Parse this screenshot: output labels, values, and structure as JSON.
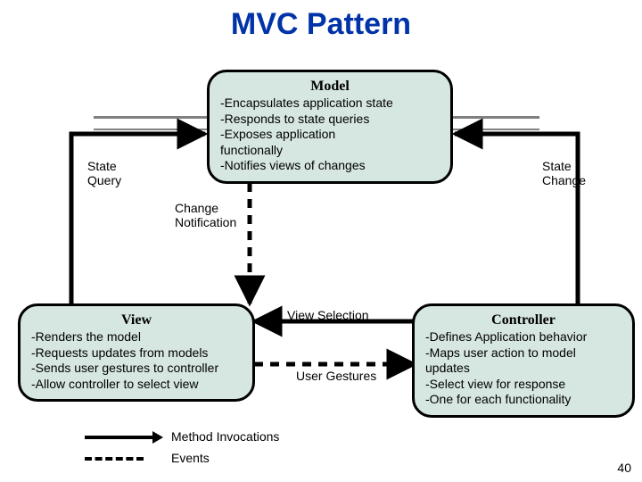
{
  "title": "MVC Pattern",
  "slide_number": "40",
  "model": {
    "heading": "Model",
    "l1": "-Encapsulates application state",
    "l2": "-Responds to state queries",
    "l3": "-Exposes application",
    "l4": " functionally",
    "l5": "-Notifies views of changes"
  },
  "view": {
    "heading": "View",
    "l1": "-Renders the model",
    "l2": "-Requests updates from models",
    "l3": "-Sends user gestures to controller",
    "l4": "-Allow controller to select view"
  },
  "controller": {
    "heading": "Controller",
    "l1": "-Defines Application behavior",
    "l2": "-Maps user action to model",
    "l3": " updates",
    "l4": "-Select view for response",
    "l5": "-One for each functionality"
  },
  "labels": {
    "state_query": "State\nQuery",
    "state_change": "State\nChange",
    "change_notification": "Change\nNotification",
    "view_selection": "View Selection",
    "user_gestures": "User Gestures"
  },
  "legend": {
    "solid": "Method Invocations",
    "dashed": "Events"
  },
  "colors": {
    "title": "#0033a8",
    "box_bg": "#d6e6e1",
    "rule": "#808080"
  }
}
